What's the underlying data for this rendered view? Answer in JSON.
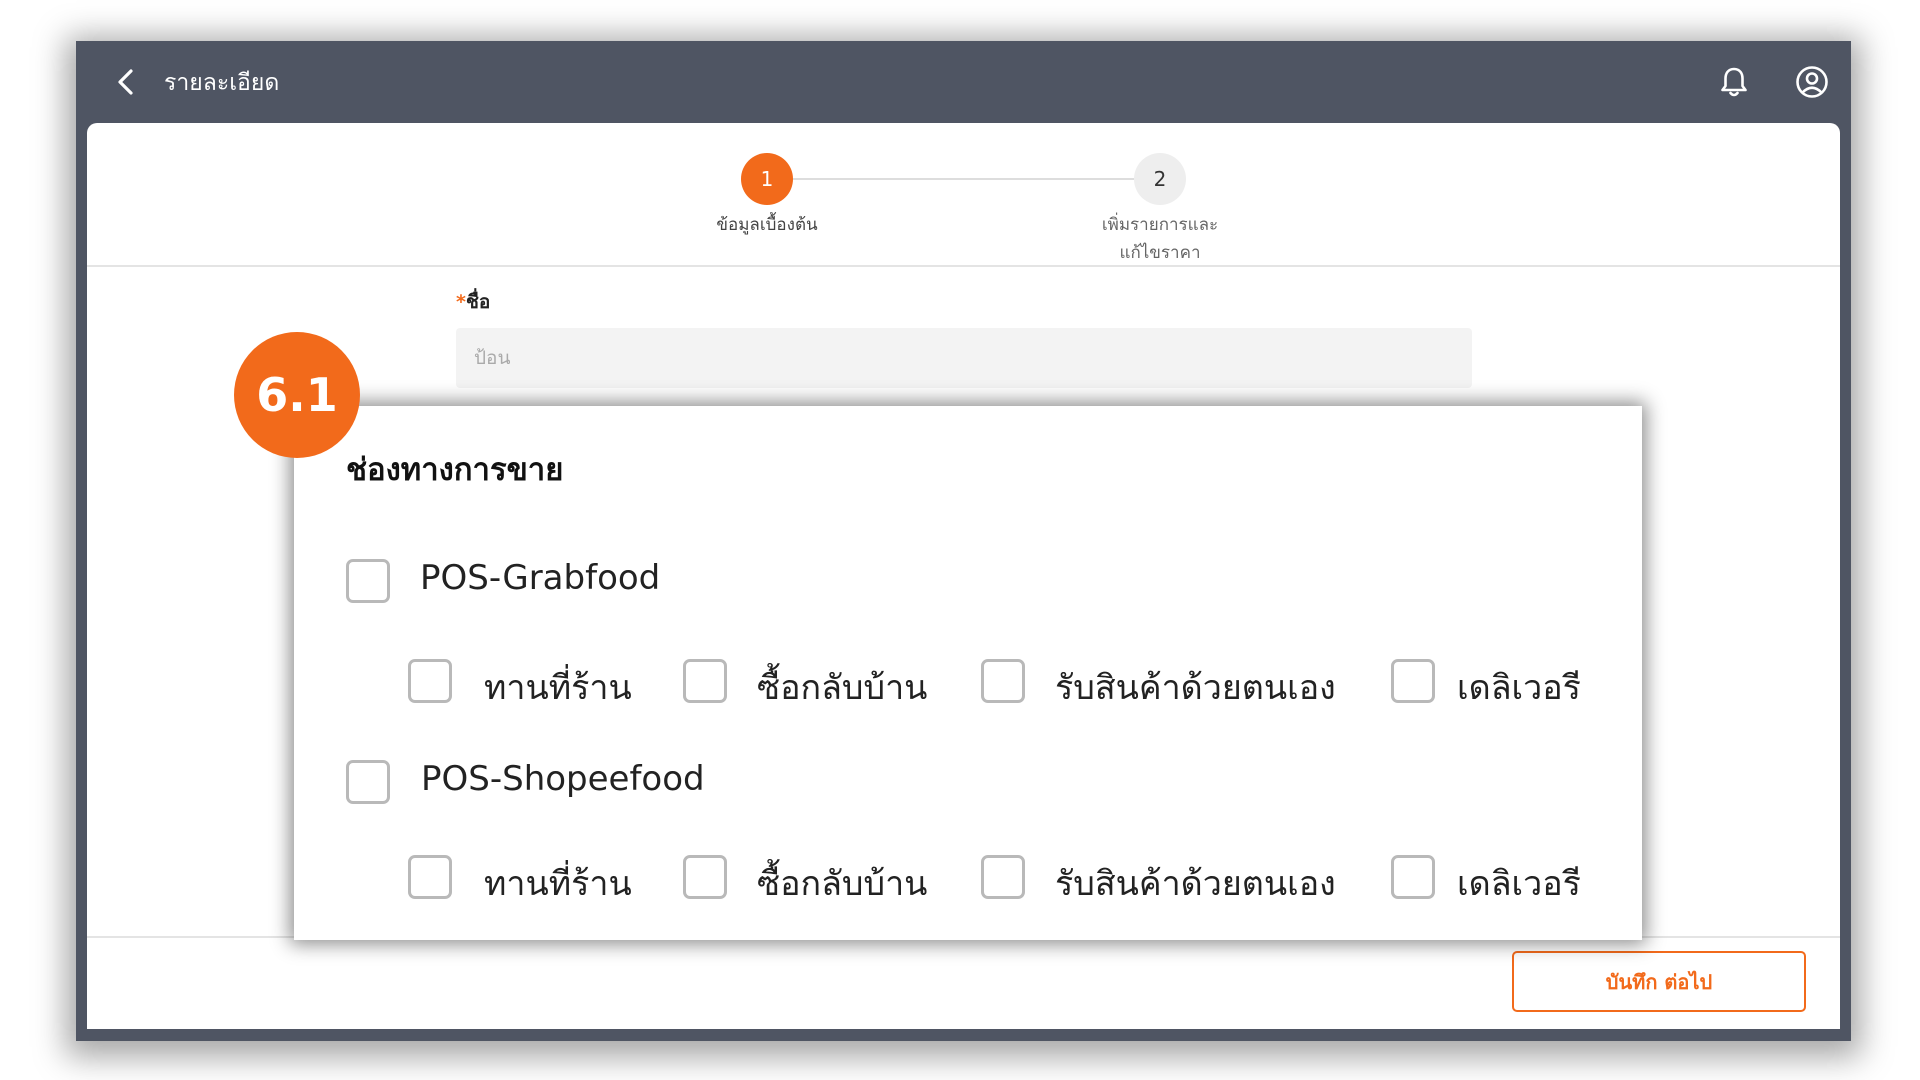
{
  "header": {
    "title": "รายละเอียด",
    "back_icon": "chevron-left-icon",
    "notification_icon": "bell-icon",
    "account_icon": "user-circle-icon"
  },
  "stepper": {
    "steps": [
      {
        "number": "1",
        "label": "ข้อมูลเบื้องต้น",
        "state": "active"
      },
      {
        "number": "2",
        "label_line1": "เพิ่มรายการและ",
        "label_line2": "แก้ไขราคา",
        "state": "inactive"
      }
    ]
  },
  "form": {
    "name_label": "ชื่อ",
    "required_mark": "*",
    "name_placeholder": "ป้อน"
  },
  "badge": {
    "text": "6.1"
  },
  "sales_channels": {
    "title": "ช่องทางการขาย",
    "groups": [
      {
        "label": "POS-Grabfood",
        "checked": false,
        "options": [
          {
            "label": "ทานที่ร้าน",
            "checked": false
          },
          {
            "label": "ซื้อกลับบ้าน",
            "checked": false
          },
          {
            "label": "รับสินค้าด้วยตนเอง",
            "checked": false
          },
          {
            "label": "เดลิเวอรี",
            "checked": false
          }
        ]
      },
      {
        "label": "POS-Shopeefood",
        "checked": false,
        "options": [
          {
            "label": "ทานที่ร้าน",
            "checked": false
          },
          {
            "label": "ซื้อกลับบ้าน",
            "checked": false
          },
          {
            "label": "รับสินค้าด้วยตนเอง",
            "checked": false
          },
          {
            "label": "เดลิเวอรี",
            "checked": false
          }
        ]
      }
    ]
  },
  "footer": {
    "save_next_label": "บันทึก ต่อไป"
  },
  "colors": {
    "accent": "#f26a1b",
    "topbar": "#4f5563"
  }
}
